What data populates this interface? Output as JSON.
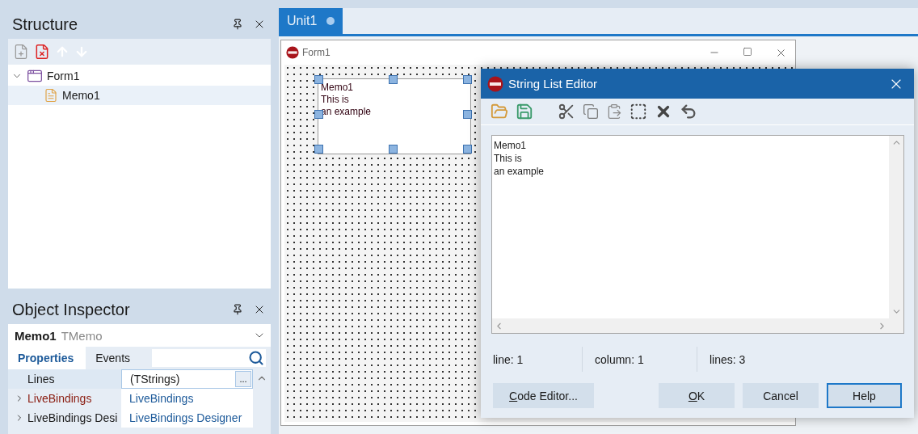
{
  "structure": {
    "title": "Structure",
    "tree": [
      {
        "label": "Form1",
        "expanded": true,
        "selected": false,
        "children": [
          {
            "label": "Memo1",
            "selected": true
          }
        ]
      }
    ]
  },
  "object_inspector": {
    "title": "Object Inspector",
    "object_name": "Memo1",
    "object_type": "TMemo",
    "tabs": [
      {
        "label": "Properties",
        "selected": true
      },
      {
        "label": "Events",
        "selected": false
      }
    ],
    "properties": [
      {
        "name": "Lines",
        "value": "(TStrings)",
        "editor_button": "...",
        "expandable": false,
        "selected": true,
        "highlighted": false
      },
      {
        "name": "LiveBindings",
        "value": "LiveBindings",
        "expandable": true,
        "selected": false,
        "highlighted": true
      },
      {
        "name": "LiveBindings Desi",
        "value": "LiveBindings Designer",
        "expandable": true,
        "selected": false,
        "highlighted": false
      }
    ]
  },
  "editor_tabs": [
    {
      "label": "Unit1",
      "selected": true,
      "modified": true
    }
  ],
  "form": {
    "title": "Form1",
    "memo_lines": [
      "Memo1",
      "This is",
      "an example"
    ]
  },
  "dialog": {
    "title": "String List Editor",
    "lines": [
      "Memo1",
      "This is",
      "an example"
    ],
    "status": [
      "line: 1",
      "column: 1",
      "lines: 3"
    ],
    "buttons": [
      {
        "label": "Code Editor...",
        "focused": false
      },
      {
        "label": "OK",
        "focused": false
      },
      {
        "label": "Cancel",
        "focused": false
      },
      {
        "label": "Help",
        "focused": true
      }
    ]
  }
}
